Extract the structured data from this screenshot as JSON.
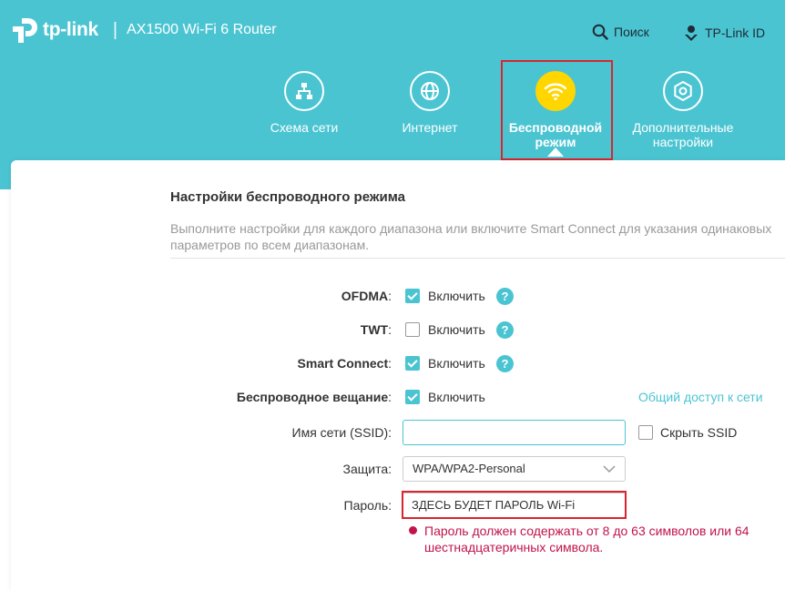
{
  "header": {
    "logo_text": "tp-link",
    "separator": "|",
    "model": "AX1500 Wi-Fi 6 Router",
    "search_label": "Поиск",
    "account_label": "TP-Link ID"
  },
  "nav": [
    {
      "label": "Схема сети",
      "icon": "network-map-icon",
      "active": false
    },
    {
      "label": "Интернет",
      "icon": "globe-icon",
      "active": false
    },
    {
      "label": "Беспроводной режим",
      "icon": "wifi-icon",
      "active": true
    },
    {
      "label": "Дополнительные настройки",
      "icon": "gear-icon",
      "active": false
    }
  ],
  "section": {
    "title": "Настройки беспроводного режима",
    "description": "Выполните настройки для каждого диапазона или включите Smart Connect для указания одинаковых параметров по всем диапазонам."
  },
  "fields": {
    "ofdma": {
      "label": "OFDMA",
      "colon": ":",
      "checked": true,
      "option": "Включить"
    },
    "twt": {
      "label": "TWT",
      "colon": ":",
      "checked": false,
      "option": "Включить"
    },
    "smart_connect": {
      "label": "Smart Connect",
      "colon": ":",
      "checked": true,
      "option": "Включить"
    },
    "broadcast": {
      "label": "Беспроводное вещание",
      "colon": ":",
      "checked": true,
      "option": "Включить"
    },
    "share_link": "Общий доступ к сети",
    "ssid": {
      "label": "Имя сети (SSID):",
      "value": "",
      "hide_label": "Скрыть SSID",
      "hide_checked": false
    },
    "security": {
      "label": "Защита:",
      "value": "WPA/WPA2-Personal"
    },
    "password": {
      "label": "Пароль:",
      "value": "ЗДЕСЬ БУДЕТ ПАРОЛЬ Wi-Fi"
    },
    "error": "Пароль должен содержать от 8 до 63 символов или 64 шестнадцатеричных символа."
  },
  "help_symbol": "?",
  "colors": {
    "accent": "#4bc4d2",
    "active_icon": "#ffd600",
    "highlight": "#d9252f",
    "error": "#c1144b"
  }
}
